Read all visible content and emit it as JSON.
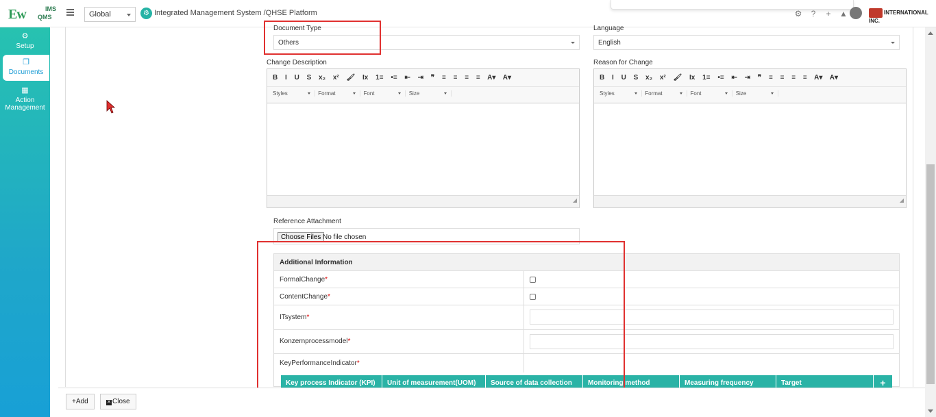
{
  "header": {
    "logo_main": "Ew",
    "logo_ims": "IMS",
    "logo_qms": "QMS",
    "scope_select": "Global",
    "app_title": "Integrated Management System /QHSE Platform",
    "brand": "INTERNATIONAL INC."
  },
  "sidebar": {
    "items": [
      {
        "label": "Setup",
        "icon": "gears-icon"
      },
      {
        "label": "Documents",
        "icon": "documents-icon"
      },
      {
        "label": "Action Management",
        "icon": "building-icon"
      }
    ]
  },
  "form": {
    "document_type_label": "Document Type",
    "document_type_value": "Others",
    "language_label": "Language",
    "language_value": "English",
    "change_description_label": "Change Description",
    "reason_label": "Reason for Change",
    "editor_toolbar": [
      "B",
      "I",
      "U",
      "S",
      "x₂",
      "x²",
      "🖌",
      "Ix",
      "1≡",
      "•≡",
      "⇤",
      "⇥",
      "❞",
      "≡",
      "≡",
      "≡",
      "≡",
      "A▾",
      "A▾"
    ],
    "editor_dropdowns": [
      "Styles",
      "Format",
      "Font",
      "Size"
    ],
    "reference_label": "Reference Attachment",
    "file_button": "Choose Files",
    "file_status": "No file chosen"
  },
  "additional_info": {
    "title": "Additional Information",
    "rows": [
      {
        "label": "FormalChange",
        "required": "*"
      },
      {
        "label": "ContentChange",
        "required": "*"
      },
      {
        "label": "ITsystem",
        "required": "*"
      },
      {
        "label": "Konzernprocessmodel",
        "required": "*"
      },
      {
        "label": "KeyPerformanceIndicator",
        "required": "*"
      }
    ],
    "kpi_columns": [
      "Key process Indicator (KPI)",
      "Unit of measurement(UOM)",
      "Source of data collection",
      "Monitoring method",
      "Measuring frequency",
      "Target",
      "+"
    ]
  },
  "footer": {
    "add_label": "+Add",
    "close_label": "Close"
  },
  "colors": {
    "accent": "#2ab3a6",
    "highlight": "#e0302f"
  }
}
